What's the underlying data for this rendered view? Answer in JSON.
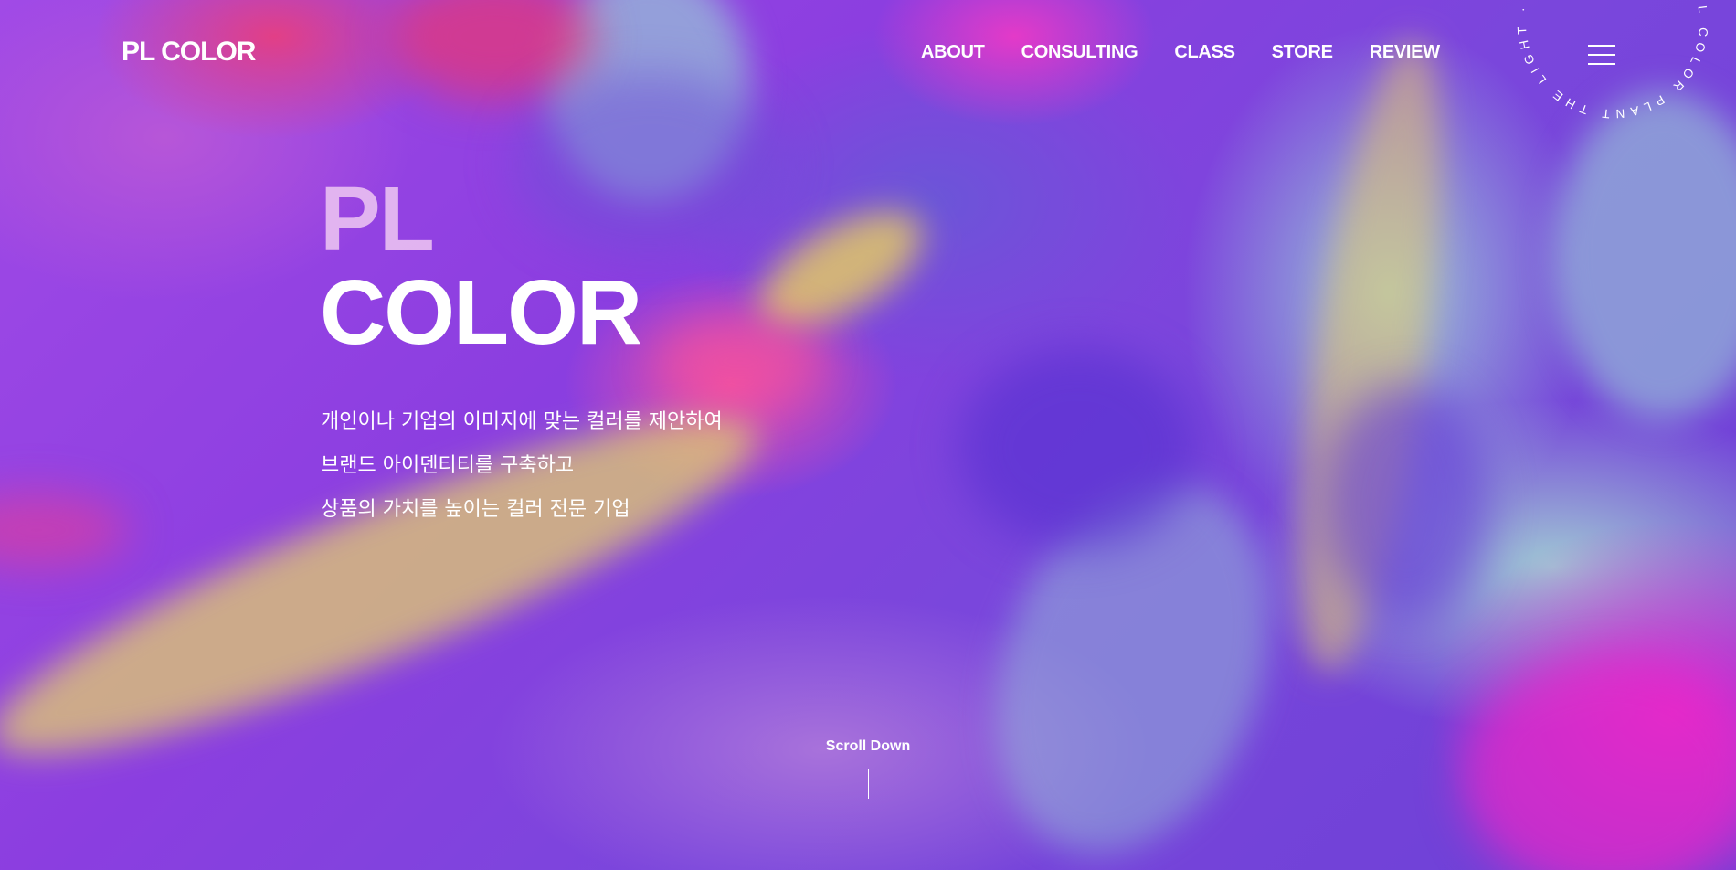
{
  "brand": {
    "logo_text": "PL COLOR"
  },
  "nav": {
    "items": [
      {
        "label": "ABOUT"
      },
      {
        "label": "CONSULTING"
      },
      {
        "label": "CLASS"
      },
      {
        "label": "STORE"
      },
      {
        "label": "REVIEW"
      }
    ],
    "menu_icon": "hamburger-menu-icon"
  },
  "badge": {
    "circular_text": "PL COLOR PLANT THE LIGHT · PL COLOR PLANT THE LIGHT ·"
  },
  "hero": {
    "title_line1": "PL",
    "title_line2": "COLOR",
    "description": [
      "개인이나 기업의 이미지에 맞는 컬러를 제안하여",
      "브랜드 아이덴티티를 구축하고",
      "상품의 가치를 높이는 컬러 전문 기업"
    ]
  },
  "scroll": {
    "label": "Scroll Down"
  },
  "colors": {
    "text": "#ffffff",
    "title_faded": "#eec8f2",
    "bg_purple": "#8b3ee0",
    "accent_pink": "#e22dcf",
    "accent_teal": "#9ac3d8",
    "accent_yellow": "#e9c257"
  }
}
